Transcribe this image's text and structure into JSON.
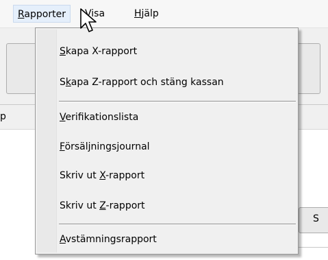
{
  "menubar": {
    "items": [
      {
        "label": "Rapporter",
        "mnemonic": "R",
        "rest": "apporter"
      },
      {
        "label": "Visa",
        "mnemonic": "V",
        "rest": "isa"
      },
      {
        "label": "Hjälp",
        "mnemonic": "H",
        "rest": "jälp"
      }
    ]
  },
  "background": {
    "left_fragment": "p",
    "right_fragment": "S"
  },
  "dropdown": {
    "items": [
      {
        "label": "Skapa X-rapport",
        "pre": "",
        "mnemonic": "S",
        "post": "kapa X-rapport"
      },
      {
        "label": "Skapa Z-rapport och stäng kassan",
        "pre": "S",
        "mnemonic": "k",
        "post": "apa Z-rapport och stäng kassan"
      },
      {
        "label": "Verifikationslista",
        "pre": "",
        "mnemonic": "V",
        "post": "erifikationslista"
      },
      {
        "label": "Försäljningsjournal",
        "pre": "",
        "mnemonic": "F",
        "post": "örsäljningsjournal"
      },
      {
        "label": "Skriv ut X-rapport",
        "pre": "Skriv ut ",
        "mnemonic": "X",
        "post": "-rapport"
      },
      {
        "label": "Skriv ut Z-rapport",
        "pre": "Skriv ut ",
        "mnemonic": "Z",
        "post": "-rapport"
      },
      {
        "label": "Avstämningsrapport",
        "pre": "",
        "mnemonic": "A",
        "post": "vstämningsrapport"
      }
    ]
  },
  "icons": {
    "cursor": "arrow-pointer-icon"
  }
}
